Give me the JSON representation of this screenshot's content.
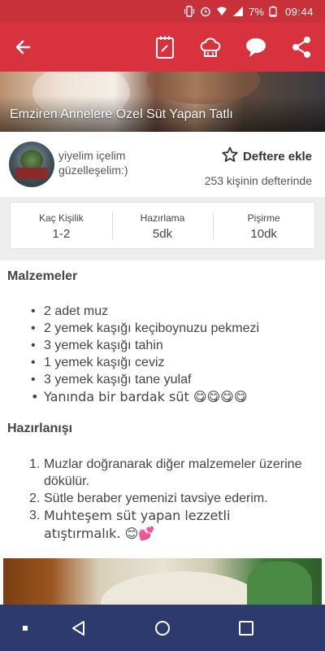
{
  "status_bar": {
    "time": "09:44",
    "battery": "7%"
  },
  "app_bar": {
    "back_icon": "back-arrow-icon",
    "actions": [
      "recipe-note-icon",
      "chef-hat-icon",
      "chat-bubble-icon",
      "share-icon"
    ]
  },
  "recipe": {
    "title": "Emziren Annelere Özel Süt Yapan Tatlı"
  },
  "author": {
    "name": "yiyelim içelim güzelleşelim:)",
    "save_label": "Deftere ekle",
    "save_count": "253 kişinin defterinde"
  },
  "info": [
    {
      "label": "Kaç Kişilik",
      "value": "1-2"
    },
    {
      "label": "Hazırlama",
      "value": "5dk"
    },
    {
      "label": "Pişirme",
      "value": "10dk"
    }
  ],
  "ingredients_title": "Malzemeler",
  "ingredients": [
    "2 adet muz",
    "2 yemek kaşığı keçiboynuzu pekmezi",
    "3 yemek kaşığı tahin",
    "1 yemek kaşığı  ceviz",
    "3 yemek kaşığı  tane yulaf",
    "Yanında bir bardak süt 😋😋😋😋"
  ],
  "steps_title": "Hazırlanışı",
  "steps": [
    {
      "num": "1.",
      "text": "Muzlar doğranarak diğer malzemeler üzerine dökülür."
    },
    {
      "num": "2.",
      "text": "Sütle beraber yemenizi tavsiye ederim."
    },
    {
      "num": "3.",
      "text": "Muhteşem süt yapan lezzetli atıştırmalık. 😊💕"
    }
  ],
  "colors": {
    "primary": "#d9323f",
    "status": "#c8303a",
    "nav": "#2c3a6e"
  }
}
